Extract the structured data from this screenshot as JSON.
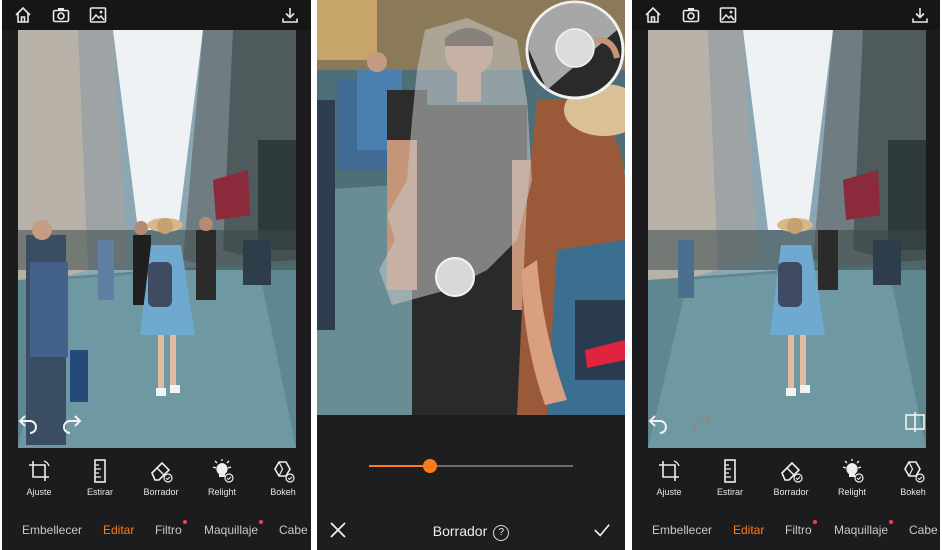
{
  "screens": [
    {
      "id": "editor-before",
      "tools": [
        {
          "label": "Ajuste",
          "icon": "crop-rotate-icon"
        },
        {
          "label": "Estirar",
          "icon": "ruler-icon"
        },
        {
          "label": "Borrador",
          "icon": "eraser-icon"
        },
        {
          "label": "Relight",
          "icon": "bulb-icon"
        },
        {
          "label": "Bokeh",
          "icon": "hexagon-blur-icon"
        }
      ],
      "tabs": [
        {
          "label": "Embellecer"
        },
        {
          "label": "Editar"
        },
        {
          "label": "Filtro"
        },
        {
          "label": "Maquillaje"
        },
        {
          "label": "Cabe"
        }
      ],
      "active_tab": "Editar"
    },
    {
      "id": "eraser-mode",
      "title": "Borrador",
      "help_symbol": "?",
      "brush_size_fraction": 0.3
    },
    {
      "id": "editor-after",
      "tools": [
        {
          "label": "Ajuste",
          "icon": "crop-rotate-icon"
        },
        {
          "label": "Estirar",
          "icon": "ruler-icon"
        },
        {
          "label": "Borrador",
          "icon": "eraser-icon"
        },
        {
          "label": "Relight",
          "icon": "bulb-icon"
        },
        {
          "label": "Bokeh",
          "icon": "hexagon-blur-icon"
        }
      ],
      "tabs": [
        {
          "label": "Embellecer"
        },
        {
          "label": "Editar"
        },
        {
          "label": "Filtro"
        },
        {
          "label": "Maquillaje"
        },
        {
          "label": "Cabe"
        }
      ],
      "active_tab": "Editar"
    }
  ],
  "colors": {
    "accent": "#ff7a18",
    "badge_dot": "#ff3b3b",
    "toolbar_bg": "#1c1c1e"
  }
}
